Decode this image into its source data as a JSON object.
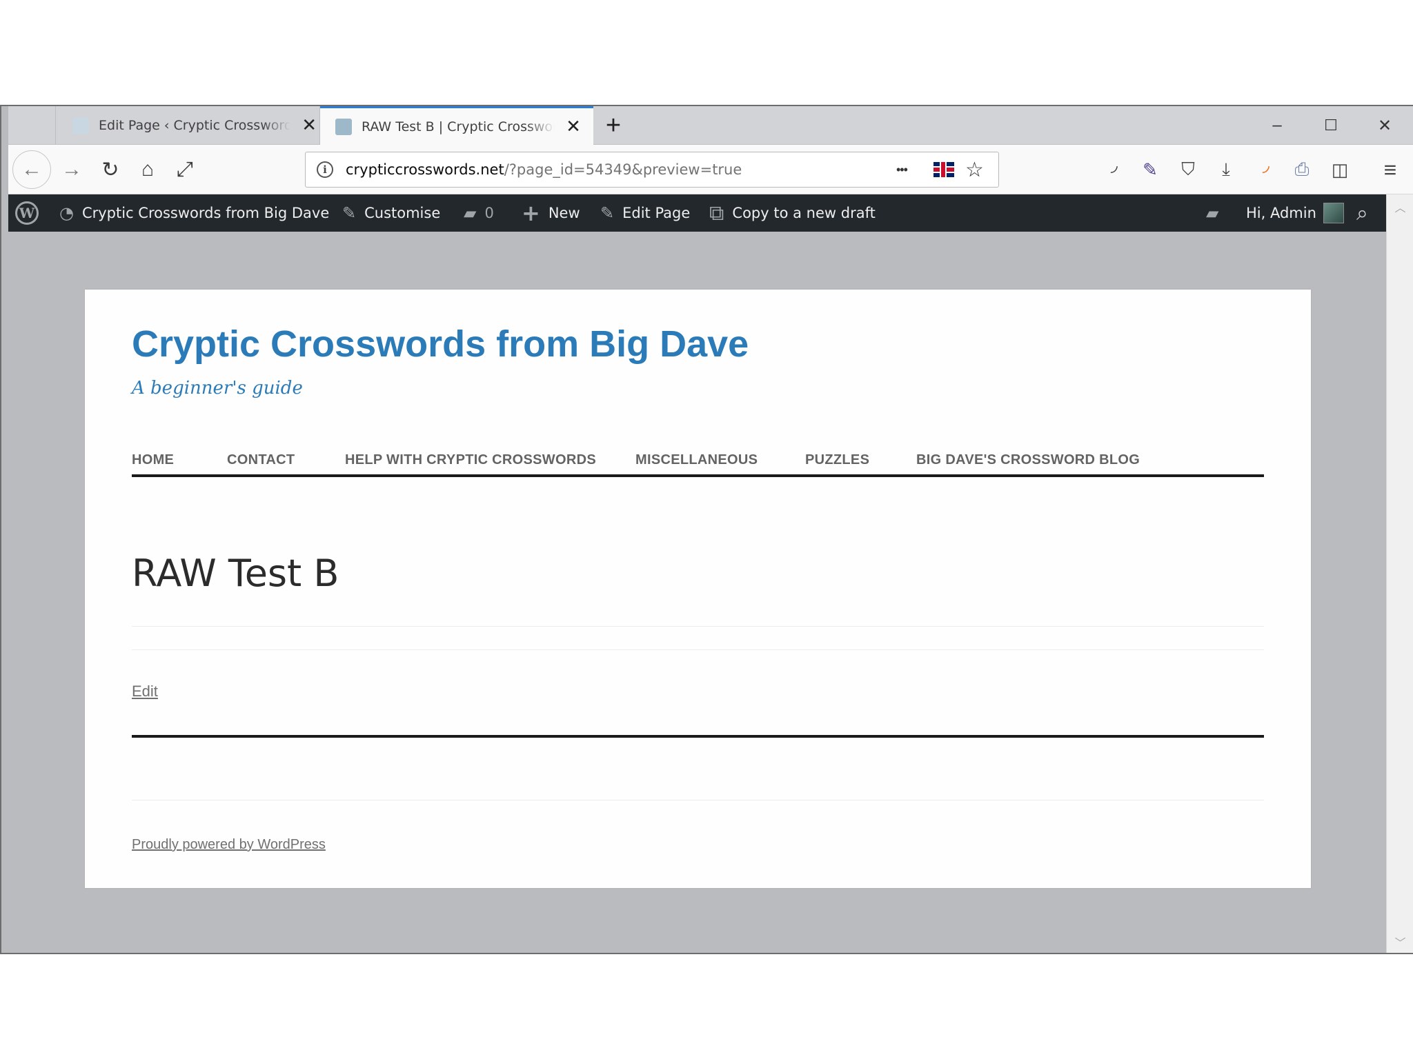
{
  "browser": {
    "tabs": [
      {
        "title": "Edit Page ‹ Cryptic Crosswords"
      },
      {
        "title": "RAW Test B | Cryptic Crosswords"
      }
    ],
    "new_tab": "+",
    "close_glyph": "✕",
    "window_controls": {
      "minimize": "–",
      "maximize": "☐",
      "close": "✕"
    },
    "nav": {
      "back": "←",
      "forward": "→",
      "reload": "↻",
      "home": "⌂",
      "fullscreen": "⤢"
    },
    "url": {
      "host": "crypticcrosswords.net",
      "path": "/?page_id=54349&preview=true"
    },
    "url_buttons": {
      "more": "•••",
      "bookmark": "☆"
    },
    "toolbar_icons": [
      "rss-icon",
      "eyedropper-icon",
      "shield-icon",
      "download-icon",
      "feed-icon",
      "printer-icon",
      "sidebar-icon",
      "menu-icon"
    ],
    "toolbar_glyphs": {
      "rss": "◝",
      "eyedropper": "✎",
      "shield": "⛉",
      "download": "⤓",
      "feed": "◝",
      "printer": "⎙",
      "sidebar": "◫",
      "menu": "≡"
    }
  },
  "adminbar": {
    "wp_logo": "W",
    "site_name": "Cryptic Crosswords from Big Dave",
    "customise": "Customise",
    "comments_count": "0",
    "new": "New",
    "edit_page": "Edit Page",
    "copy_draft": "Copy to a new draft",
    "greeting": "Hi, Admin",
    "glyphs": {
      "dashboard": "◔",
      "brush": "✎",
      "comment": "▰",
      "plus": "+",
      "pencil": "✎",
      "copy": "⧉",
      "notes": "▰",
      "search": "⌕"
    }
  },
  "site": {
    "title": "Cryptic Crosswords from Big Dave",
    "tagline": "A beginner's guide",
    "menu": [
      "HOME",
      "CONTACT",
      "HELP WITH CRYPTIC CROSSWORDS",
      "MISCELLANEOUS",
      "PUZZLES",
      "BIG DAVE'S CROSSWORD BLOG"
    ]
  },
  "page": {
    "title": "RAW Test B",
    "edit_link": "Edit",
    "footer": "Proudly powered by WordPress"
  },
  "colors": {
    "accent": "#2b7bb9",
    "adminbar": "#23282d",
    "tab_highlight": "#2b7dd6"
  }
}
